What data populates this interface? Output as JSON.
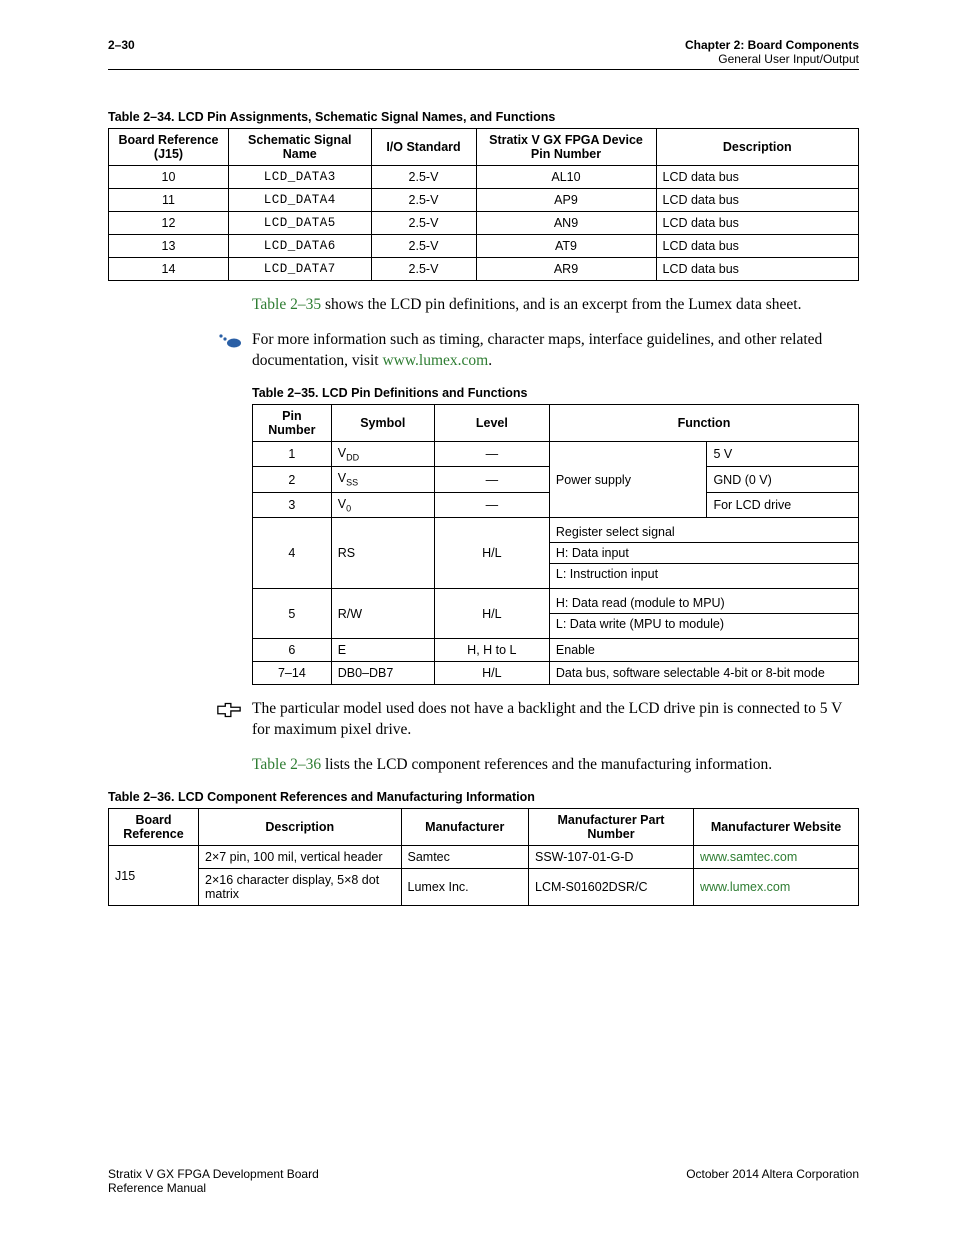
{
  "header": {
    "page": "2–30",
    "chapter": "Chapter 2:  Board Components",
    "section": "General User Input/Output"
  },
  "table34": {
    "caption": "Table 2–34.  LCD Pin Assignments, Schematic Signal Names, and Functions",
    "headers": {
      "h1": "Board Reference (J15)",
      "h2": "Schematic Signal Name",
      "h3": "I/O Standard",
      "h4": "Stratix V GX FPGA Device Pin Number",
      "h5": "Description"
    },
    "rows": [
      {
        "ref": "10",
        "sig": "LCD_DATA3",
        "io": "2.5-V",
        "pin": "AL10",
        "desc": "LCD data bus"
      },
      {
        "ref": "11",
        "sig": "LCD_DATA4",
        "io": "2.5-V",
        "pin": "AP9",
        "desc": "LCD data bus"
      },
      {
        "ref": "12",
        "sig": "LCD_DATA5",
        "io": "2.5-V",
        "pin": "AN9",
        "desc": "LCD data bus"
      },
      {
        "ref": "13",
        "sig": "LCD_DATA6",
        "io": "2.5-V",
        "pin": "AT9",
        "desc": "LCD data bus"
      },
      {
        "ref": "14",
        "sig": "LCD_DATA7",
        "io": "2.5-V",
        "pin": "AR9",
        "desc": "LCD data bus"
      }
    ]
  },
  "para1": {
    "link": "Table 2–35",
    "rest": " shows the LCD pin definitions, and is an excerpt from the Lumex data sheet."
  },
  "note1": {
    "text_before": "For more information such as timing, character maps, interface guidelines, and other related documentation, visit ",
    "link": "www.lumex.com",
    "text_after": "."
  },
  "table35": {
    "caption": "Table 2–35.  LCD Pin Definitions and Functions",
    "headers": {
      "h1": "Pin Number",
      "h2": "Symbol",
      "h3": "Level",
      "h4": "Function"
    },
    "group1": {
      "r1": {
        "pin": "1",
        "sym_base": "V",
        "sym_sub": "DD",
        "level": "—",
        "func2": "5 V"
      },
      "r2": {
        "pin": "2",
        "sym_base": "V",
        "sym_sub": "SS",
        "level": "—",
        "func2": "GND (0 V)"
      },
      "r3": {
        "pin": "3",
        "sym_base": "V",
        "sym_sub": "0",
        "level": "—",
        "func2": "For LCD drive"
      },
      "func1": "Power supply"
    },
    "row4": {
      "pin": "4",
      "sym": "RS",
      "level": "H/L",
      "fA": "Register select signal",
      "fB": "H: Data input",
      "fC": "L: Instruction input"
    },
    "row5": {
      "pin": "5",
      "sym": "R/W",
      "level": "H/L",
      "fA": "H: Data read (module to MPU)",
      "fB": "L: Data write (MPU to module)"
    },
    "row6": {
      "pin": "6",
      "sym": "E",
      "level": "H, H to L",
      "func": "Enable"
    },
    "row7": {
      "pin": "7–14",
      "sym": "DB0–DB7",
      "level": "H/L",
      "func": "Data bus, software selectable 4-bit or 8-bit mode"
    }
  },
  "note2": {
    "text": "The particular model used does not have a backlight and the LCD drive pin is connected to 5 V for maximum pixel drive."
  },
  "para2": {
    "link": "Table 2–36",
    "rest": " lists the LCD component references and the manufacturing information."
  },
  "table36": {
    "caption": "Table 2–36.  LCD Component References and Manufacturing Information",
    "headers": {
      "h1": "Board Reference",
      "h2": "Description",
      "h3": "Manufacturer",
      "h4": "Manufacturer Part Number",
      "h5": "Manufacturer Website"
    },
    "board_ref": "J15",
    "rows": [
      {
        "desc": "2×7 pin, 100 mil, vertical header",
        "man": "Samtec",
        "part": "SSW-107-01-G-D",
        "site": "www.samtec.com"
      },
      {
        "desc": "2×16 character display, 5×8 dot matrix",
        "man": "Lumex Inc.",
        "part": "LCM-S01602DSR/C",
        "site": "www.lumex.com"
      }
    ]
  },
  "footer": {
    "left1": "Stratix V GX FPGA Development Board",
    "left2": "Reference Manual",
    "right": "October 2014   Altera Corporation"
  }
}
